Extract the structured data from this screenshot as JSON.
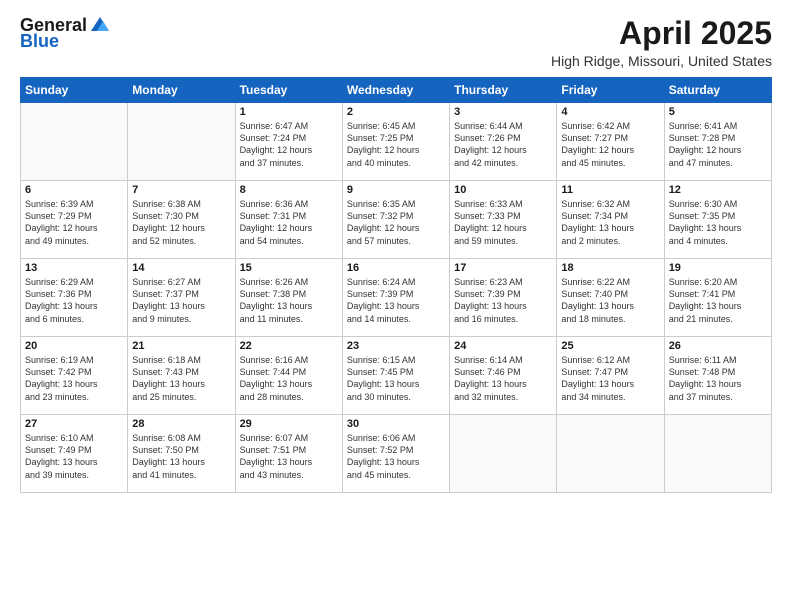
{
  "header": {
    "logo_general": "General",
    "logo_blue": "Blue",
    "title": "April 2025",
    "subtitle": "High Ridge, Missouri, United States"
  },
  "weekdays": [
    "Sunday",
    "Monday",
    "Tuesday",
    "Wednesday",
    "Thursday",
    "Friday",
    "Saturday"
  ],
  "weeks": [
    [
      {
        "day": "",
        "info": ""
      },
      {
        "day": "",
        "info": ""
      },
      {
        "day": "1",
        "info": "Sunrise: 6:47 AM\nSunset: 7:24 PM\nDaylight: 12 hours\nand 37 minutes."
      },
      {
        "day": "2",
        "info": "Sunrise: 6:45 AM\nSunset: 7:25 PM\nDaylight: 12 hours\nand 40 minutes."
      },
      {
        "day": "3",
        "info": "Sunrise: 6:44 AM\nSunset: 7:26 PM\nDaylight: 12 hours\nand 42 minutes."
      },
      {
        "day": "4",
        "info": "Sunrise: 6:42 AM\nSunset: 7:27 PM\nDaylight: 12 hours\nand 45 minutes."
      },
      {
        "day": "5",
        "info": "Sunrise: 6:41 AM\nSunset: 7:28 PM\nDaylight: 12 hours\nand 47 minutes."
      }
    ],
    [
      {
        "day": "6",
        "info": "Sunrise: 6:39 AM\nSunset: 7:29 PM\nDaylight: 12 hours\nand 49 minutes."
      },
      {
        "day": "7",
        "info": "Sunrise: 6:38 AM\nSunset: 7:30 PM\nDaylight: 12 hours\nand 52 minutes."
      },
      {
        "day": "8",
        "info": "Sunrise: 6:36 AM\nSunset: 7:31 PM\nDaylight: 12 hours\nand 54 minutes."
      },
      {
        "day": "9",
        "info": "Sunrise: 6:35 AM\nSunset: 7:32 PM\nDaylight: 12 hours\nand 57 minutes."
      },
      {
        "day": "10",
        "info": "Sunrise: 6:33 AM\nSunset: 7:33 PM\nDaylight: 12 hours\nand 59 minutes."
      },
      {
        "day": "11",
        "info": "Sunrise: 6:32 AM\nSunset: 7:34 PM\nDaylight: 13 hours\nand 2 minutes."
      },
      {
        "day": "12",
        "info": "Sunrise: 6:30 AM\nSunset: 7:35 PM\nDaylight: 13 hours\nand 4 minutes."
      }
    ],
    [
      {
        "day": "13",
        "info": "Sunrise: 6:29 AM\nSunset: 7:36 PM\nDaylight: 13 hours\nand 6 minutes."
      },
      {
        "day": "14",
        "info": "Sunrise: 6:27 AM\nSunset: 7:37 PM\nDaylight: 13 hours\nand 9 minutes."
      },
      {
        "day": "15",
        "info": "Sunrise: 6:26 AM\nSunset: 7:38 PM\nDaylight: 13 hours\nand 11 minutes."
      },
      {
        "day": "16",
        "info": "Sunrise: 6:24 AM\nSunset: 7:39 PM\nDaylight: 13 hours\nand 14 minutes."
      },
      {
        "day": "17",
        "info": "Sunrise: 6:23 AM\nSunset: 7:39 PM\nDaylight: 13 hours\nand 16 minutes."
      },
      {
        "day": "18",
        "info": "Sunrise: 6:22 AM\nSunset: 7:40 PM\nDaylight: 13 hours\nand 18 minutes."
      },
      {
        "day": "19",
        "info": "Sunrise: 6:20 AM\nSunset: 7:41 PM\nDaylight: 13 hours\nand 21 minutes."
      }
    ],
    [
      {
        "day": "20",
        "info": "Sunrise: 6:19 AM\nSunset: 7:42 PM\nDaylight: 13 hours\nand 23 minutes."
      },
      {
        "day": "21",
        "info": "Sunrise: 6:18 AM\nSunset: 7:43 PM\nDaylight: 13 hours\nand 25 minutes."
      },
      {
        "day": "22",
        "info": "Sunrise: 6:16 AM\nSunset: 7:44 PM\nDaylight: 13 hours\nand 28 minutes."
      },
      {
        "day": "23",
        "info": "Sunrise: 6:15 AM\nSunset: 7:45 PM\nDaylight: 13 hours\nand 30 minutes."
      },
      {
        "day": "24",
        "info": "Sunrise: 6:14 AM\nSunset: 7:46 PM\nDaylight: 13 hours\nand 32 minutes."
      },
      {
        "day": "25",
        "info": "Sunrise: 6:12 AM\nSunset: 7:47 PM\nDaylight: 13 hours\nand 34 minutes."
      },
      {
        "day": "26",
        "info": "Sunrise: 6:11 AM\nSunset: 7:48 PM\nDaylight: 13 hours\nand 37 minutes."
      }
    ],
    [
      {
        "day": "27",
        "info": "Sunrise: 6:10 AM\nSunset: 7:49 PM\nDaylight: 13 hours\nand 39 minutes."
      },
      {
        "day": "28",
        "info": "Sunrise: 6:08 AM\nSunset: 7:50 PM\nDaylight: 13 hours\nand 41 minutes."
      },
      {
        "day": "29",
        "info": "Sunrise: 6:07 AM\nSunset: 7:51 PM\nDaylight: 13 hours\nand 43 minutes."
      },
      {
        "day": "30",
        "info": "Sunrise: 6:06 AM\nSunset: 7:52 PM\nDaylight: 13 hours\nand 45 minutes."
      },
      {
        "day": "",
        "info": ""
      },
      {
        "day": "",
        "info": ""
      },
      {
        "day": "",
        "info": ""
      }
    ]
  ]
}
